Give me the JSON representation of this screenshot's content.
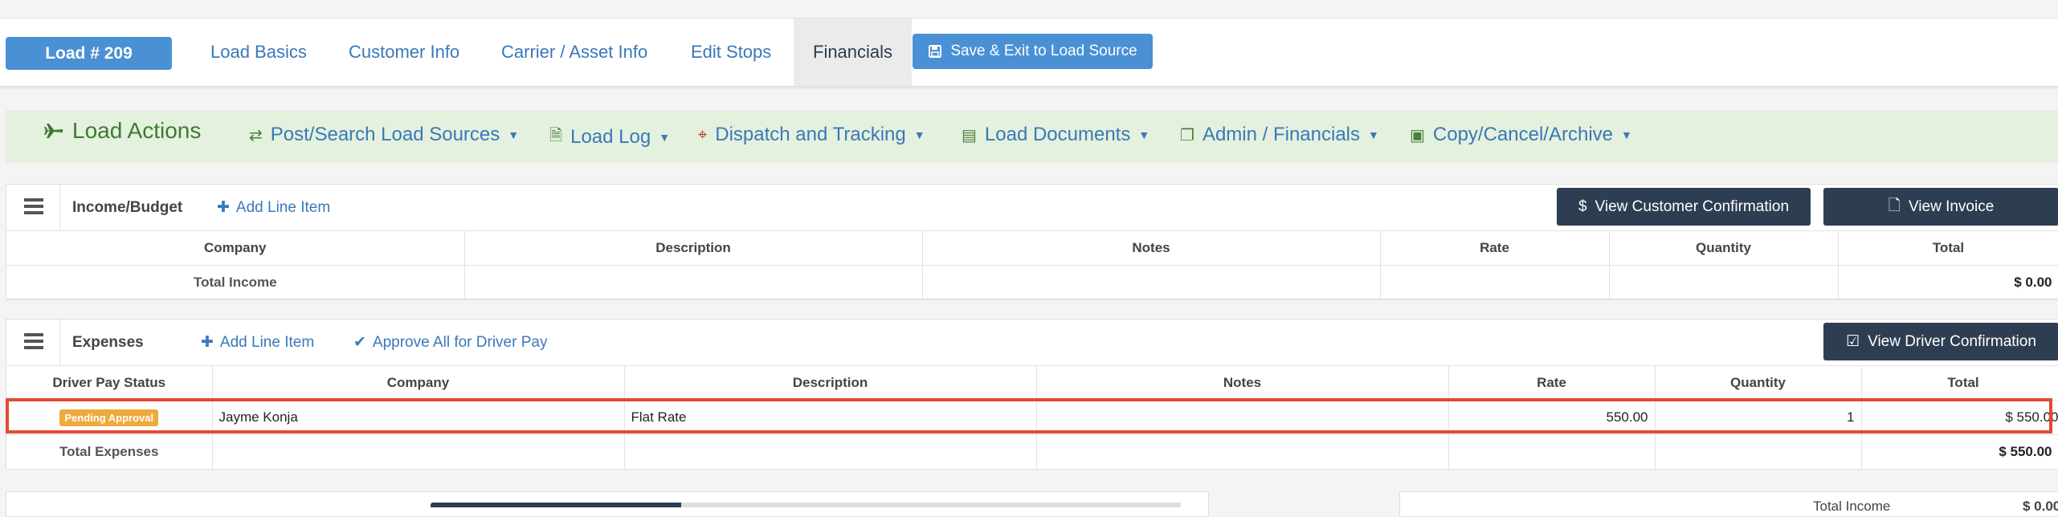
{
  "tabs": {
    "load_badge": "Load # 209",
    "items": [
      {
        "label": "Load Basics"
      },
      {
        "label": "Customer Info"
      },
      {
        "label": "Carrier / Asset Info"
      },
      {
        "label": "Edit Stops"
      },
      {
        "label": "Financials"
      }
    ],
    "active": "Financials",
    "save_exit": "Save & Exit to Load Source"
  },
  "actions": {
    "title": "Load Actions",
    "items": [
      {
        "label": "Post/Search Load Sources",
        "icon": "retweet-icon"
      },
      {
        "label": "Load Log",
        "icon": "file-search-icon"
      },
      {
        "label": "Dispatch and Tracking",
        "icon": "crosshairs-icon"
      },
      {
        "label": "Load Documents",
        "icon": "file-text-icon"
      },
      {
        "label": "Admin / Financials",
        "icon": "copy-icon"
      },
      {
        "label": "Copy/Cancel/Archive",
        "icon": "archive-icon"
      }
    ]
  },
  "income": {
    "title": "Income/Budget",
    "add_line": "Add Line Item",
    "view_customer_confirmation": "View Customer Confirmation",
    "view_invoice": "View Invoice",
    "columns": [
      "Company",
      "Description",
      "Notes",
      "Rate",
      "Quantity",
      "Total"
    ],
    "total_label": "Total Income",
    "total_value": "$ 0.00"
  },
  "expenses": {
    "title": "Expenses",
    "add_line": "Add Line Item",
    "approve_all": "Approve All for Driver Pay",
    "view_driver_confirmation": "View Driver Confirmation",
    "columns": [
      "Driver Pay Status",
      "Company",
      "Description",
      "Notes",
      "Rate",
      "Quantity",
      "Total"
    ],
    "rows": [
      {
        "status": "Pending Approval",
        "company": "Jayme Konja",
        "description": "Flat Rate",
        "notes": "",
        "rate": "550.00",
        "quantity": "1",
        "total": "$ 550.00"
      }
    ],
    "total_label": "Total Expenses",
    "total_value": "$ 550.00"
  },
  "summary": {
    "total_income_label": "Total Income",
    "total_income_value": "$ 0.00"
  },
  "colors": {
    "primary": "#4a90d4",
    "dark_button": "#2e3e52",
    "actions_bg": "#e4f1de",
    "actions_title": "#3e7b32",
    "pending_badge": "#efa93c",
    "highlight": "#e14a36"
  }
}
